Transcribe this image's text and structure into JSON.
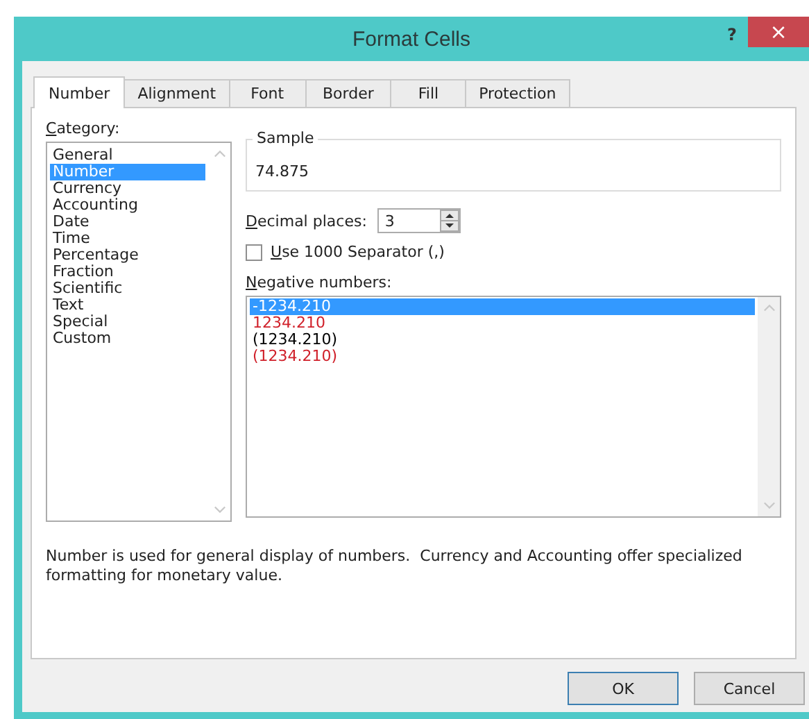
{
  "window": {
    "title": "Format Cells",
    "help": "?",
    "close": "×"
  },
  "tabs": [
    {
      "label": "Number",
      "selected": true
    },
    {
      "label": "Alignment",
      "selected": false
    },
    {
      "label": "Font",
      "selected": false
    },
    {
      "label": "Border",
      "selected": false
    },
    {
      "label": "Fill",
      "selected": false
    },
    {
      "label": "Protection",
      "selected": false
    }
  ],
  "category": {
    "label": "Category:",
    "items": [
      {
        "label": "General",
        "selected": false
      },
      {
        "label": "Number",
        "selected": true
      },
      {
        "label": "Currency",
        "selected": false
      },
      {
        "label": "Accounting",
        "selected": false
      },
      {
        "label": "Date",
        "selected": false
      },
      {
        "label": "Time",
        "selected": false
      },
      {
        "label": "Percentage",
        "selected": false
      },
      {
        "label": "Fraction",
        "selected": false
      },
      {
        "label": "Scientific",
        "selected": false
      },
      {
        "label": "Text",
        "selected": false
      },
      {
        "label": "Special",
        "selected": false
      },
      {
        "label": "Custom",
        "selected": false
      }
    ]
  },
  "sample": {
    "label": "Sample",
    "value": "74.875"
  },
  "decimal_places": {
    "label": "Decimal places:",
    "value": "3"
  },
  "separator": {
    "label": "Use 1000 Separator (,)",
    "checked": false
  },
  "negative_numbers": {
    "label": "Negative numbers:",
    "items": [
      {
        "label": "-1234.210",
        "selected": true
      },
      {
        "label": "1234.210",
        "color": "#d0202a",
        "selected": false
      },
      {
        "label": "(1234.210)",
        "color": "#000000",
        "selected": false
      },
      {
        "label": "(1234.210)",
        "color": "#d0202a",
        "selected": false
      }
    ]
  },
  "description": "Number is used for general display of numbers.  Currency and Accounting offer specialized formatting for monetary value.",
  "buttons": [
    {
      "label": "OK",
      "default": true
    },
    {
      "label": "Cancel",
      "default": false
    }
  ]
}
